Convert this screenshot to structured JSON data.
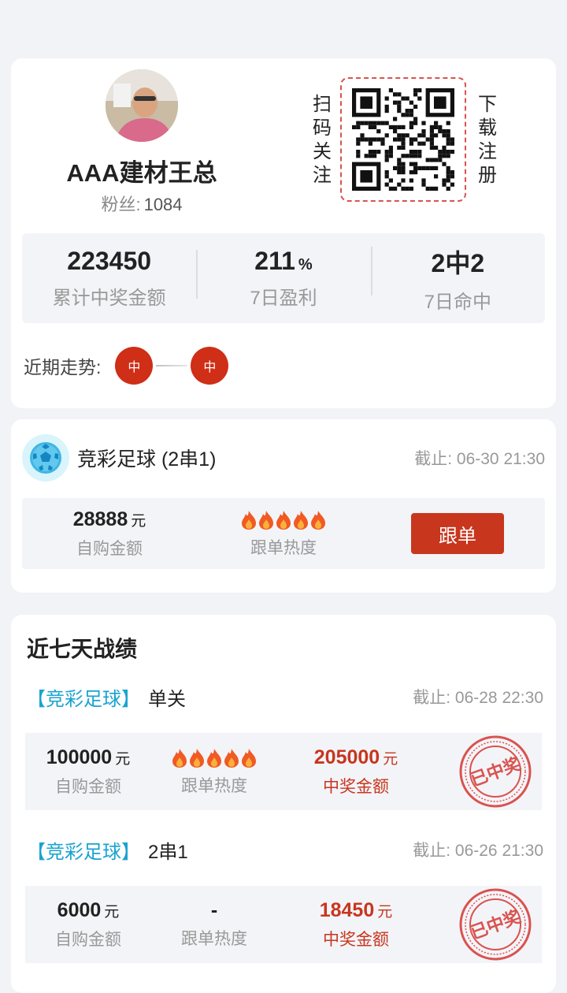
{
  "profile": {
    "name": "AAA建材王总",
    "fans_label": "粉丝:",
    "fans_count": "1084",
    "scan_text": "扫码关注",
    "download_text": "下载注册",
    "stats": [
      {
        "value": "223450",
        "unit": "",
        "label": "累计中奖金额"
      },
      {
        "value": "211",
        "unit": "%",
        "label": "7日盈利"
      },
      {
        "value": "2中2",
        "unit": "",
        "label": "7日命中"
      }
    ],
    "trend_label": "近期走势:",
    "trend": [
      "中",
      "中"
    ]
  },
  "plan": {
    "title": "竞彩足球 (2串1)",
    "deadline": "截止: 06-30 21:30",
    "buy_amount": "28888",
    "buy_unit": "元",
    "buy_label": "自购金额",
    "heat_label": "跟单热度",
    "heat_level": 5,
    "follow_button": "跟单"
  },
  "records": {
    "title": "近七天战绩",
    "items": [
      {
        "game": "【竞彩足球】",
        "type": "单关",
        "deadline": "截止: 06-28 22:30",
        "buy_amount": "100000",
        "buy_unit": "元",
        "buy_label": "自购金额",
        "heat": "",
        "heat_level": 5,
        "heat_label": "跟单热度",
        "win_amount": "205000",
        "win_unit": "元",
        "win_label": "中奖金额",
        "stamp": "已中奖"
      },
      {
        "game": "【竞彩足球】",
        "type": "2串1",
        "deadline": "截止: 06-26 21:30",
        "buy_amount": "6000",
        "buy_unit": "元",
        "buy_label": "自购金额",
        "heat": "-",
        "heat_level": 0,
        "heat_label": "跟单热度",
        "win_amount": "18450",
        "win_unit": "元",
        "win_label": "中奖金额",
        "stamp": "已中奖"
      }
    ]
  },
  "colors": {
    "accent": "#c8361e",
    "tag": "#1aa3d0",
    "stamp": "#d9534f"
  }
}
